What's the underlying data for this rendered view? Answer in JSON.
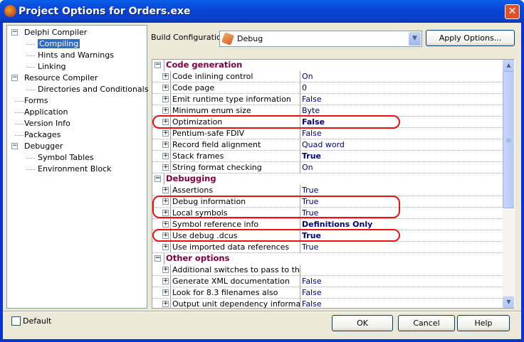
{
  "window": {
    "title": "Project Options for Orders.exe",
    "close_label": "✕"
  },
  "tree": [
    {
      "label": "Delphi Compiler",
      "level": 0,
      "expander": "−"
    },
    {
      "label": "Compiling",
      "level": 1,
      "selected": true
    },
    {
      "label": "Hints and Warnings",
      "level": 1
    },
    {
      "label": "Linking",
      "level": 1
    },
    {
      "label": "Resource Compiler",
      "level": 0,
      "expander": "−"
    },
    {
      "label": "Directories and Conditionals",
      "level": 1
    },
    {
      "label": "Forms",
      "level": 0
    },
    {
      "label": "Application",
      "level": 0
    },
    {
      "label": "Version Info",
      "level": 0
    },
    {
      "label": "Packages",
      "level": 0
    },
    {
      "label": "Debugger",
      "level": 0,
      "expander": "−"
    },
    {
      "label": "Symbol Tables",
      "level": 1
    },
    {
      "label": "Environment Block",
      "level": 1
    }
  ],
  "build": {
    "label": "Build Configuration",
    "value": "Debug",
    "icon": "wrench-icon",
    "apply_label": "Apply Options..."
  },
  "grid": [
    {
      "category": "Code generation"
    },
    {
      "name": "Code inlining control",
      "value": "On"
    },
    {
      "name": "Code page",
      "value": "0"
    },
    {
      "name": "Emit runtime type information",
      "value": "False"
    },
    {
      "name": "Minimum enum size",
      "value": "Byte"
    },
    {
      "name": "Optimization",
      "value": "False",
      "bold": true
    },
    {
      "name": "Pentium-safe FDIV",
      "value": "False"
    },
    {
      "name": "Record field alignment",
      "value": "Quad word"
    },
    {
      "name": "Stack frames",
      "value": "True",
      "bold": true
    },
    {
      "name": "String format checking",
      "value": "On"
    },
    {
      "category": "Debugging"
    },
    {
      "name": "Assertions",
      "value": "True"
    },
    {
      "name": "Debug information",
      "value": "True"
    },
    {
      "name": "Local symbols",
      "value": "True"
    },
    {
      "name": "Symbol reference info",
      "value": "Definitions Only",
      "bold": true
    },
    {
      "name": "Use debug .dcus",
      "value": "True",
      "bold": true
    },
    {
      "name": "Use imported data references",
      "value": "True"
    },
    {
      "category": "Other options"
    },
    {
      "name": "Additional switches to pass to the compiler",
      "value": ""
    },
    {
      "name": "Generate XML documentation",
      "value": "False"
    },
    {
      "name": "Look for 8.3 filenames also",
      "value": "False"
    },
    {
      "name": "Output unit dependency information",
      "value": "False"
    }
  ],
  "highlight_color": "#e81010",
  "footer": {
    "default_label": "Default",
    "default_checked": false,
    "ok": "OK",
    "cancel": "Cancel",
    "help": "Help"
  }
}
